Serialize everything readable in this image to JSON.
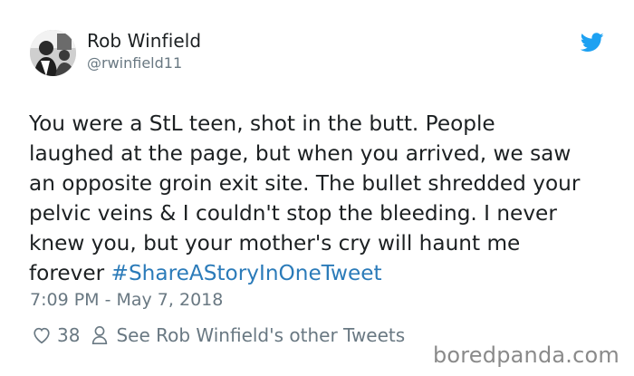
{
  "tweet": {
    "author_name": "Rob Winfield",
    "author_handle": "@rwinfield11",
    "text_body": "You were a StL teen, shot in the butt. People\nlaughed at the page, but when you arrived, we saw\nan opposite groin exit site. The bullet shredded your\npelvic veins & I couldn't stop the bleeding. I never\nknew you, but your mother's cry will haunt me\nforever ",
    "hashtag": "#ShareAStoryInOneTweet",
    "timestamp": "7:09 PM - May 7, 2018",
    "like_count": "38",
    "other_tweets_label": "See Rob Winfield's other Tweets"
  },
  "watermark": "boredpanda.com",
  "icons": {
    "brand": "twitter-bird-icon",
    "like": "heart-icon",
    "profile": "person-icon"
  },
  "colors": {
    "twitter_blue": "#1da1f2",
    "hashtag": "#2b7bb9",
    "muted": "#697882",
    "text": "#1c2022"
  }
}
